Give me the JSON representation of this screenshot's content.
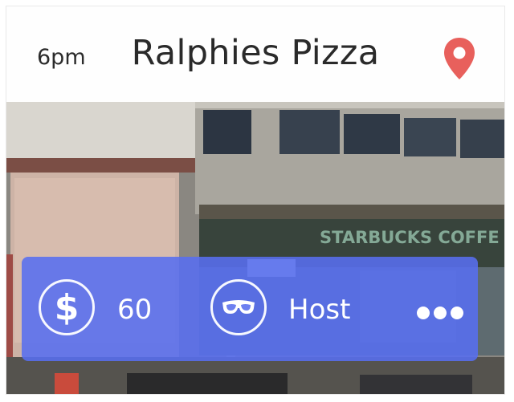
{
  "event": {
    "time": "6pm",
    "venue": "Ralphies Pizza",
    "storefront_sign": "STARBUCKS COFFE"
  },
  "details": {
    "price": "60",
    "role": "Host"
  },
  "icons": {
    "location": "map-pin-icon",
    "price": "dollar-icon",
    "role": "glasses-icon",
    "more": "more-dots-icon"
  },
  "colors": {
    "pin": "#e8605c",
    "overlay": "#586ef0"
  }
}
